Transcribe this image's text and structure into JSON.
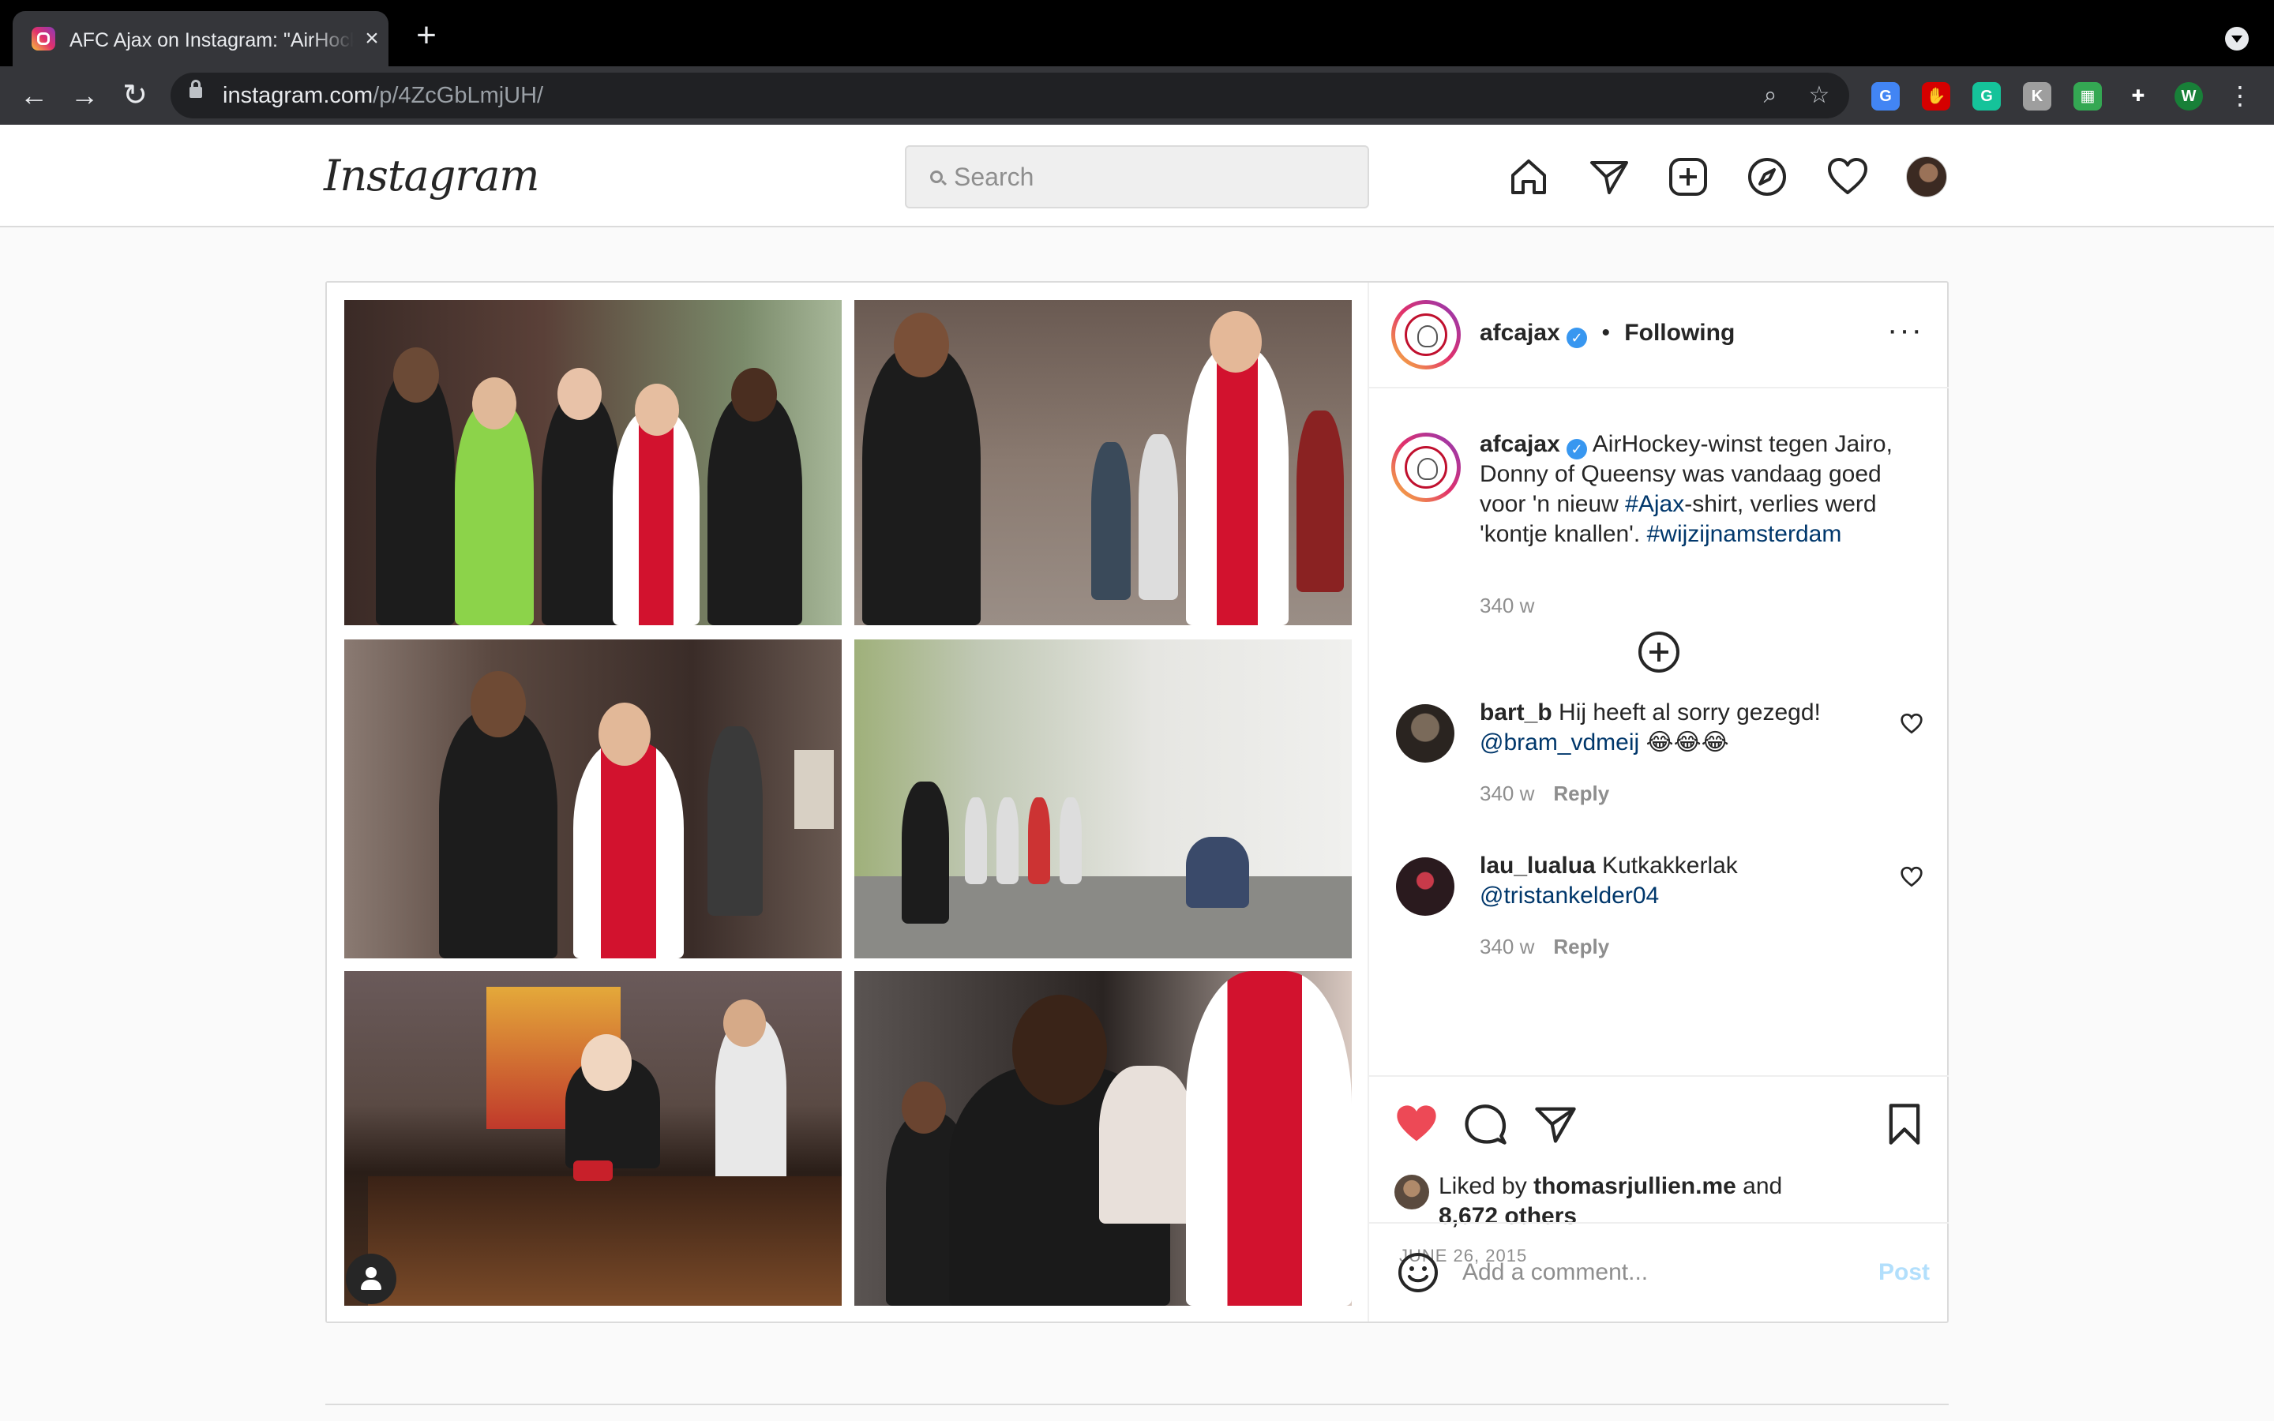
{
  "browser": {
    "tab_title": "AFC Ajax on Instagram: \"AirHockey-winst tegen Jairo,",
    "url_host": "instagram.com",
    "url_path": "/p/4ZcGbLmjUH/",
    "extensions": [
      {
        "name": "translate",
        "glyph": "G",
        "color": "#4285f4"
      },
      {
        "name": "adblock",
        "glyph": "✋",
        "color": "#d50000"
      },
      {
        "name": "grammarly",
        "glyph": "G",
        "color": "#15c39a"
      },
      {
        "name": "clipboard",
        "glyph": "K",
        "color": "#9e9e9e"
      },
      {
        "name": "maps",
        "glyph": "▦",
        "color": "#34a853"
      },
      {
        "name": "extensions",
        "glyph": "✚",
        "color": "#35363a"
      }
    ],
    "profile_initial": "W",
    "profile_color": "#188038"
  },
  "header": {
    "logo": "Instagram",
    "search_placeholder": "Search"
  },
  "post": {
    "author": "afcajax",
    "following_label": "Following",
    "caption_text": " AirHockey-winst tegen Jairo, Donny of Queensy was vandaag goed voor 'n nieuw ",
    "caption_tag1": "#Ajax",
    "caption_text2": "-shirt, verlies werd 'kontje knallen'. ",
    "caption_tag2": "#wijzijnamsterdam",
    "caption_age": "340 w",
    "comments": [
      {
        "user": "bart_b",
        "text": " Hij heeft al sorry gezegd! ",
        "mention": "@bram_vdmeij",
        "emoji": " 😂😂😂",
        "age": "340 w",
        "reply": "Reply"
      },
      {
        "user": "lau_lualua",
        "text": " Kutkakkerlak ",
        "mention": "@tristankelder04",
        "emoji": "",
        "age": "340 w",
        "reply": "Reply"
      }
    ],
    "liked_by_prefix": "Liked by ",
    "liked_by_user": "thomasrjullien.me",
    "liked_by_and": " and",
    "liked_by_others": "8,672 others",
    "date": "JUNE 26, 2015",
    "comment_placeholder": "Add a comment...",
    "post_label": "Post",
    "like_color": "#ed4956"
  }
}
